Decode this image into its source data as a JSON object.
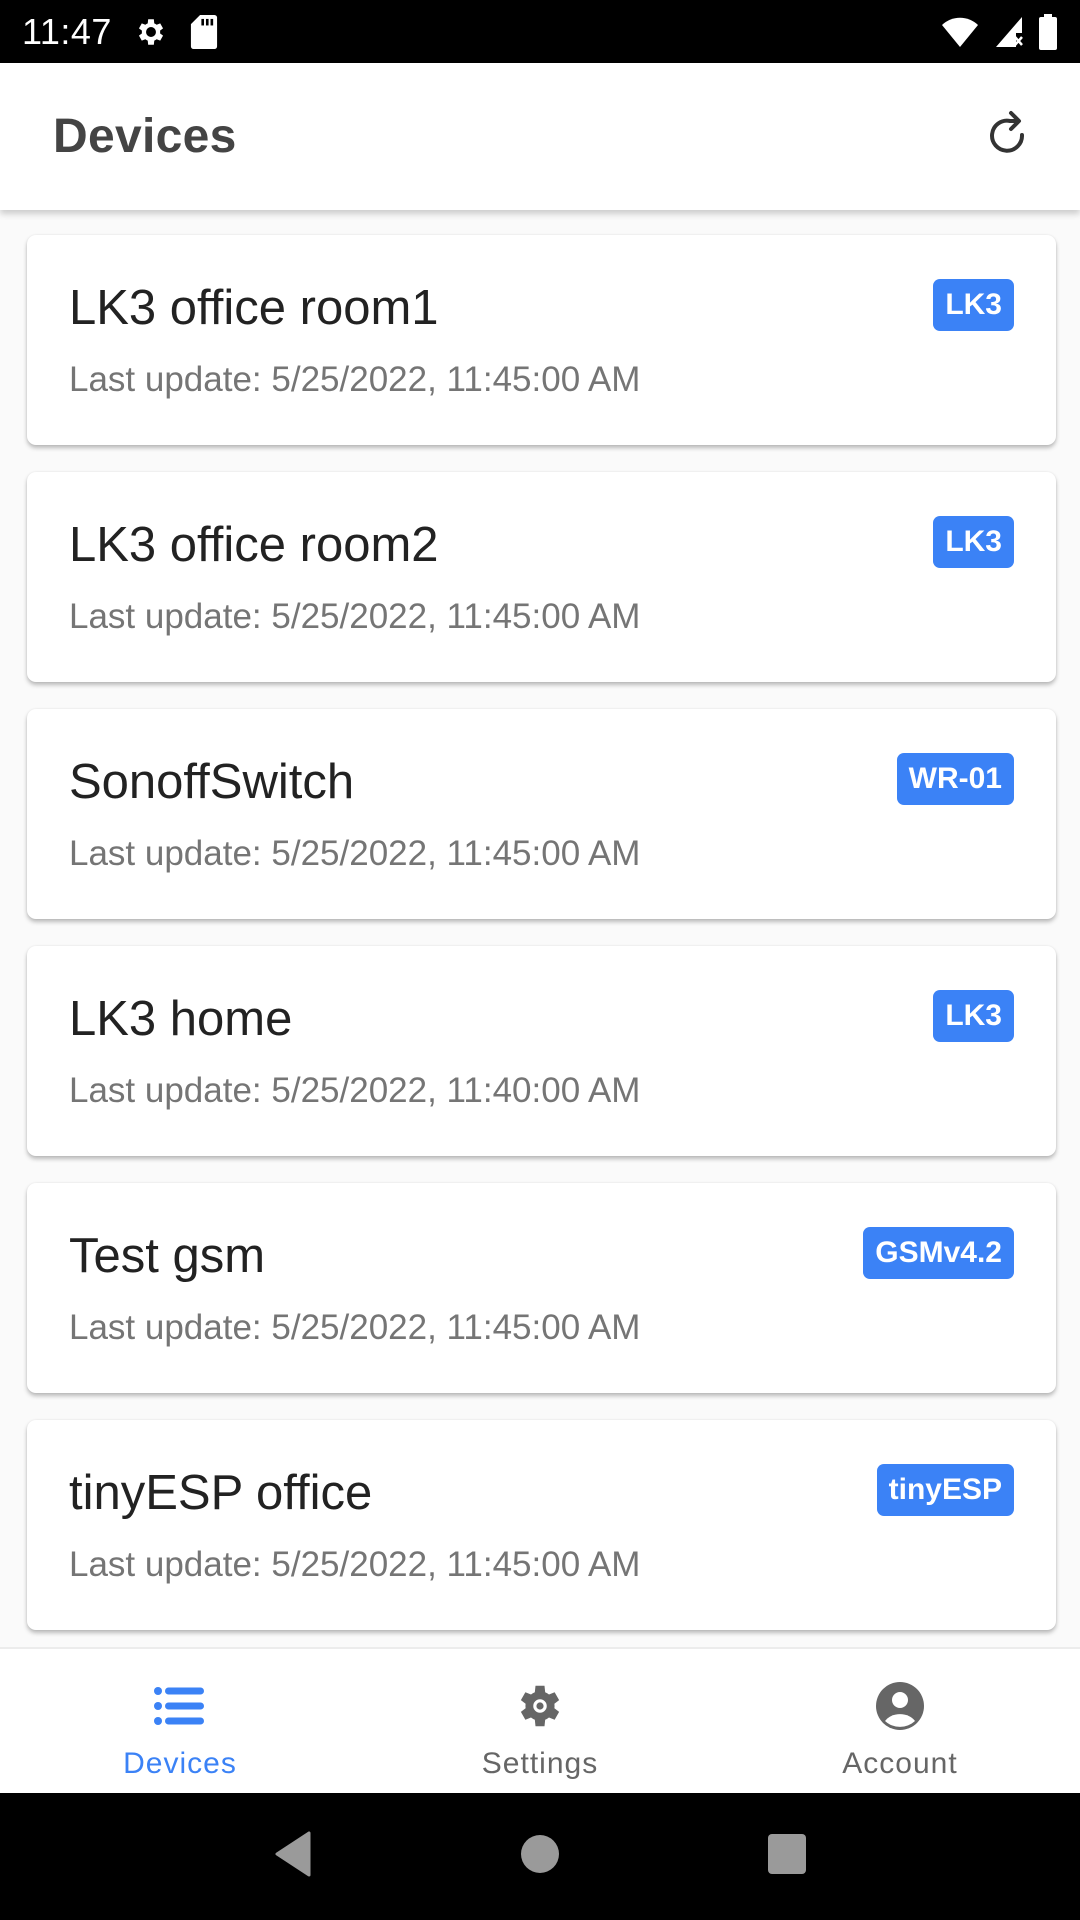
{
  "status_bar": {
    "time": "11:47",
    "left_icons": [
      "gear-icon",
      "sd-card-icon"
    ],
    "right_icons": [
      "wifi-icon",
      "signal-no-data-icon",
      "battery-icon"
    ]
  },
  "app_bar": {
    "title": "Devices",
    "action_icon": "refresh-icon"
  },
  "colors": {
    "accent": "#3b82f6",
    "title_text": "#444444",
    "device_name_text": "#222222",
    "secondary_text": "#757575",
    "inactive_nav": "#666666"
  },
  "devices": [
    {
      "name": "LK3 office room1",
      "last_update": "Last update: 5/25/2022, 11:45:00 AM",
      "badge": "LK3"
    },
    {
      "name": "LK3 office room2",
      "last_update": "Last update: 5/25/2022, 11:45:00 AM",
      "badge": "LK3"
    },
    {
      "name": "SonoffSwitch",
      "last_update": "Last update: 5/25/2022, 11:45:00 AM",
      "badge": "WR-01"
    },
    {
      "name": "LK3 home",
      "last_update": "Last update: 5/25/2022, 11:40:00 AM",
      "badge": "LK3"
    },
    {
      "name": "Test gsm",
      "last_update": "Last update: 5/25/2022, 11:45:00 AM",
      "badge": "GSMv4.2"
    },
    {
      "name": "tinyESP office",
      "last_update": "Last update: 5/25/2022, 11:45:00 AM",
      "badge": "tinyESP"
    }
  ],
  "bottom_nav": {
    "items": [
      {
        "label": "Devices",
        "icon": "list-icon",
        "active": true
      },
      {
        "label": "Settings",
        "icon": "settings-gear-icon",
        "active": false
      },
      {
        "label": "Account",
        "icon": "account-circle-icon",
        "active": false
      }
    ]
  },
  "system_nav": {
    "buttons": [
      "back-icon",
      "home-icon",
      "recents-icon"
    ]
  }
}
